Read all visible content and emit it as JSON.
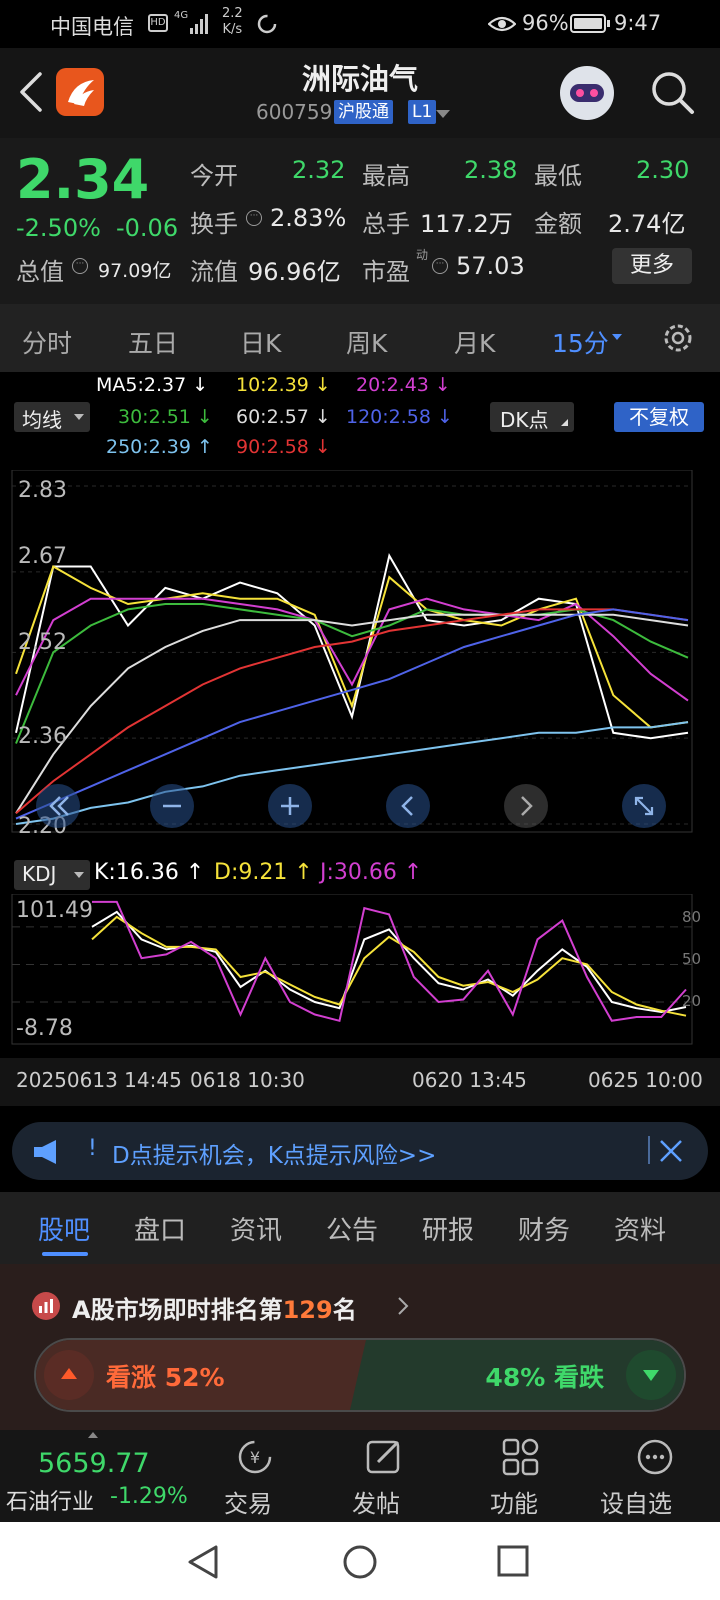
{
  "status_bar": {
    "carrier": "中国电信",
    "network": "4G",
    "speed_value": "2.2",
    "speed_unit": "K/s",
    "battery": "96%",
    "time": "9:47"
  },
  "header": {
    "stock_name": "洲际油气",
    "stock_code": "600759",
    "badge_connect": "沪股通",
    "badge_level": "L1"
  },
  "quote": {
    "price": "2.34",
    "change_pct": "-2.50%",
    "change": "-0.06",
    "open_label": "今开",
    "open": "2.32",
    "high_label": "最高",
    "high": "2.38",
    "low_label": "最低",
    "low": "2.30",
    "turnover_label": "换手",
    "turnover": "2.83%",
    "volume_label": "总手",
    "volume": "117.2万",
    "amount_label": "金额",
    "amount": "2.74亿",
    "mktcap_label": "总值",
    "mktcap": "97.09亿",
    "float_label": "流值",
    "float_value": "96.96亿",
    "pe_label": "市盈",
    "pe_sup": "动",
    "pe": "57.03",
    "more_button": "更多"
  },
  "period_tabs": [
    "分时",
    "五日",
    "日K",
    "周K",
    "月K",
    "15分"
  ],
  "active_period": 5,
  "ma_legend": {
    "selector": "均线",
    "dk_button": "DK点",
    "adjust_button": "不复权",
    "items": [
      {
        "label": "MA5:2.37 ↓",
        "color": "#ffffff"
      },
      {
        "label": "10:2.39 ↓",
        "color": "#f5e23a"
      },
      {
        "label": "20:2.43 ↓",
        "color": "#d23fd0"
      },
      {
        "label": "30:2.51 ↓",
        "color": "#3dbb3d"
      },
      {
        "label": "60:2.57 ↓",
        "color": "#dddddd"
      },
      {
        "label": "120:2.58 ↓",
        "color": "#4f63e8"
      },
      {
        "label": "250:2.39 ↑",
        "color": "#7ec3ee"
      },
      {
        "label": "90:2.58 ↓",
        "color": "#e23434"
      }
    ]
  },
  "chart_data": [
    {
      "type": "line",
      "y_ticks": [
        "2.83",
        "2.67",
        "2.52",
        "2.36",
        "2.20"
      ],
      "ylim": [
        2.2,
        2.83
      ],
      "series": [
        {
          "name": "MA5",
          "color": "#ffffff",
          "values": [
            2.37,
            2.68,
            2.68,
            2.57,
            2.64,
            2.62,
            2.65,
            2.63,
            2.57,
            2.4,
            2.7,
            2.58,
            2.57,
            2.58,
            2.62,
            2.61,
            2.37,
            2.36,
            2.37
          ]
        },
        {
          "name": "MA10",
          "color": "#f5e23a",
          "values": [
            2.48,
            2.68,
            2.64,
            2.61,
            2.62,
            2.63,
            2.62,
            2.62,
            2.59,
            2.42,
            2.66,
            2.6,
            2.58,
            2.57,
            2.6,
            2.62,
            2.44,
            2.38,
            2.39
          ]
        },
        {
          "name": "MA20",
          "color": "#d23fd0",
          "values": [
            2.44,
            2.58,
            2.62,
            2.62,
            2.62,
            2.62,
            2.61,
            2.6,
            2.58,
            2.46,
            2.6,
            2.62,
            2.6,
            2.59,
            2.58,
            2.61,
            2.55,
            2.48,
            2.43
          ]
        },
        {
          "name": "MA30",
          "color": "#3dbb3d",
          "values": [
            2.35,
            2.52,
            2.57,
            2.6,
            2.61,
            2.61,
            2.6,
            2.59,
            2.58,
            2.55,
            2.57,
            2.6,
            2.59,
            2.59,
            2.59,
            2.6,
            2.58,
            2.54,
            2.51
          ]
        },
        {
          "name": "MA60",
          "color": "#dddddd",
          "values": [
            2.22,
            2.33,
            2.42,
            2.49,
            2.53,
            2.56,
            2.58,
            2.58,
            2.58,
            2.57,
            2.58,
            2.59,
            2.59,
            2.59,
            2.59,
            2.59,
            2.59,
            2.58,
            2.57
          ]
        },
        {
          "name": "MA90",
          "color": "#e23434",
          "values": [
            2.22,
            2.28,
            2.33,
            2.38,
            2.42,
            2.46,
            2.49,
            2.51,
            2.53,
            2.54,
            2.56,
            2.57,
            2.58,
            2.59,
            2.6,
            2.6,
            2.6,
            2.59,
            2.58
          ]
        },
        {
          "name": "MA120",
          "color": "#4f63e8",
          "values": [
            2.21,
            2.24,
            2.27,
            2.3,
            2.33,
            2.36,
            2.39,
            2.41,
            2.43,
            2.45,
            2.47,
            2.5,
            2.53,
            2.55,
            2.57,
            2.59,
            2.6,
            2.59,
            2.58
          ]
        },
        {
          "name": "MA250",
          "color": "#7ec3ee",
          "values": [
            2.2,
            2.21,
            2.23,
            2.24,
            2.26,
            2.27,
            2.29,
            2.3,
            2.31,
            2.32,
            2.33,
            2.34,
            2.35,
            2.36,
            2.37,
            2.37,
            2.38,
            2.38,
            2.39
          ]
        }
      ]
    },
    {
      "type": "line",
      "y_ticks": [
        "101.49",
        "-8.78"
      ],
      "right_ticks": [
        "80",
        "50",
        "20"
      ],
      "ylim": [
        -8.78,
        101.49
      ],
      "x_ticks": [
        "20250613 14:45",
        "0618 10:30",
        "0620 13:45",
        "0625 10:00"
      ],
      "series": [
        {
          "name": "K",
          "color": "#ffffff",
          "values": [
            80,
            92,
            70,
            62,
            65,
            60,
            32,
            45,
            30,
            20,
            15,
            70,
            78,
            55,
            35,
            30,
            38,
            25,
            45,
            62,
            48,
            20,
            15,
            12,
            16
          ]
        },
        {
          "name": "D",
          "color": "#f5e23a",
          "values": [
            70,
            88,
            75,
            64,
            64,
            62,
            40,
            44,
            34,
            24,
            18,
            55,
            72,
            60,
            40,
            33,
            36,
            28,
            38,
            55,
            50,
            28,
            18,
            13,
            9
          ]
        },
        {
          "name": "J",
          "color": "#d23fd0",
          "values": [
            100,
            100,
            55,
            58,
            68,
            55,
            10,
            55,
            20,
            10,
            5,
            95,
            90,
            40,
            20,
            22,
            45,
            10,
            70,
            85,
            40,
            5,
            8,
            8,
            30
          ]
        }
      ]
    }
  ],
  "kdj_legend": {
    "selector": "KDJ",
    "k": "K:16.36 ↑",
    "d": "D:9.21 ↑",
    "j": "J:30.66 ↑"
  },
  "banner": {
    "text": "D点提示机会，K点提示风险>>"
  },
  "bottom_tabs": [
    "股吧",
    "盘口",
    "资讯",
    "公告",
    "研报",
    "财务",
    "资料"
  ],
  "active_bottom_tab": 0,
  "rank": {
    "prefix": "A股市场即时排名第",
    "number": "129",
    "suffix": "名"
  },
  "sentiment": {
    "rise_label": "看涨",
    "rise_pct": "52%",
    "fall_pct": "48%",
    "fall_label": "看跌"
  },
  "bottom_nav": {
    "index_value": "5659.77",
    "index_name": "石油行业",
    "index_change": "-1.29%",
    "items": [
      "交易",
      "发帖",
      "功能",
      "设自选"
    ]
  }
}
